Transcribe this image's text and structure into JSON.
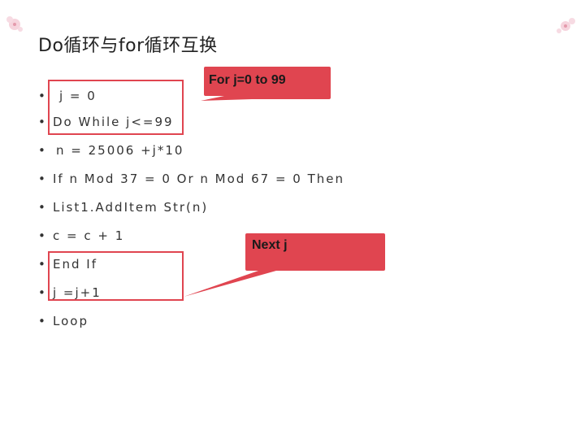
{
  "slide": {
    "title": "Do循环与for循环互换",
    "bullet_char": "•",
    "lines": [
      "j = 0",
      "Do While j<=99",
      "n = 25006 +j*10",
      "If n Mod 37 = 0 Or n Mod 67 = 0 Then",
      "List1.AddItem Str(n)",
      "c = c + 1",
      "End If",
      "j =j+1",
      "Loop"
    ]
  },
  "callouts": [
    {
      "text": "For j=0 to 99"
    },
    {
      "text": "Next j"
    }
  ],
  "colors": {
    "accent": "#e04550",
    "callout_fill": "#e04550"
  }
}
